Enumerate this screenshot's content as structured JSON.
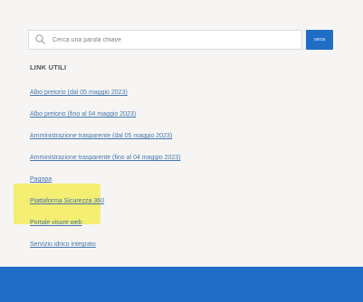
{
  "search": {
    "placeholder": "Cerca una parola chiave",
    "button_label": "cerca"
  },
  "links_section": {
    "title": "LINK UTILI",
    "items": [
      {
        "label": "Albo pretorio (dal 05 maggio 2023)"
      },
      {
        "label": "Albo pretorio (fino al 04 maggio 2023)"
      },
      {
        "label": "Amministrazione trasparente (dal 05 maggio 2023)"
      },
      {
        "label": "Amministrazione trasparente (fino al 04 maggio 2023)"
      },
      {
        "label": "Pagopa"
      },
      {
        "label": "Piattaforma Sicurezza 360"
      },
      {
        "label": "Portale visure web"
      },
      {
        "label": "Servizio idrico integrato"
      }
    ]
  },
  "colors": {
    "accent": "#1f6dc4",
    "link": "#4577b0",
    "highlight": "#f3ec5a",
    "background": "#f6f5f3"
  }
}
